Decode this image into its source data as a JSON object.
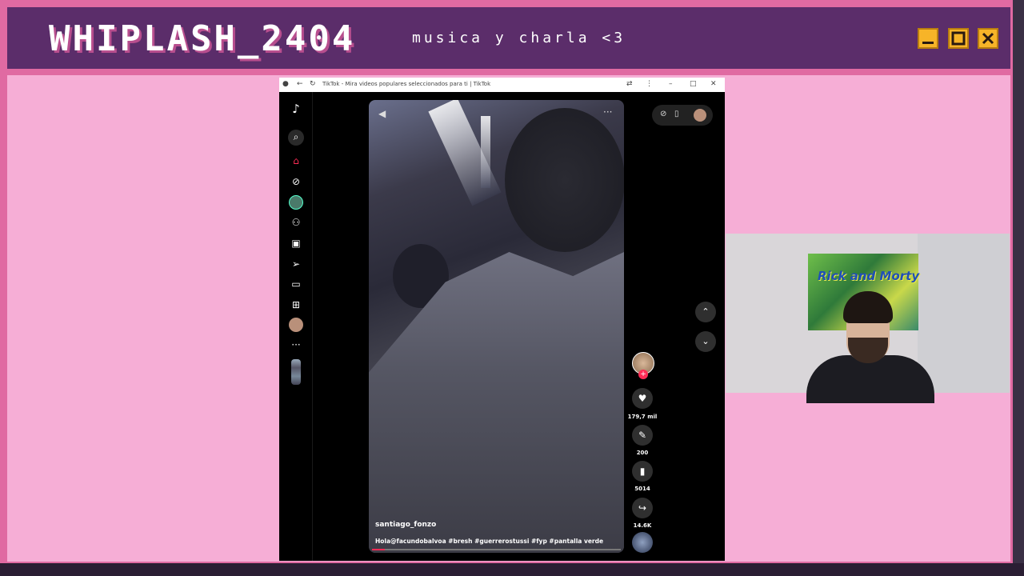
{
  "overlay": {
    "brand": "WHIPLASH_2404",
    "subtitle": "musica y charla <3",
    "window_buttons": [
      "minimize-icon",
      "maximize-icon",
      "close-icon"
    ],
    "colors": {
      "frame": "#e06aa2",
      "titlebar": "#5b2d6a",
      "content": "#f6aed6",
      "buttons": "#f7b428"
    }
  },
  "browser": {
    "tab_title": "TikTok - Mira videos populares seleccionados para ti | TikTok",
    "sidebar_icons": [
      "tiktok-logo-icon",
      "search-icon",
      "home-icon",
      "explore-icon",
      "following-icon",
      "friends-icon",
      "live-icon",
      "messages-icon",
      "inbox-icon",
      "upload-icon",
      "profile-icon",
      "more-icon"
    ]
  },
  "video": {
    "username": "santiago_fonzo",
    "caption": "Hola@facundobalvoa #bresh #guerrerostussi #fyp #pantalla verde",
    "progress": 0.05,
    "likes": "179,7 mil",
    "comments": "200",
    "saves": "5014",
    "shares": "14.6K"
  },
  "webcam": {
    "poster_text": "Rick and Morty"
  }
}
